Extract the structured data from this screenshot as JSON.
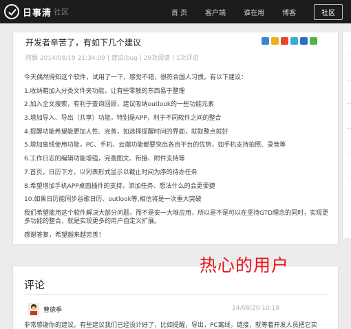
{
  "app": {
    "logo_text": "日事清",
    "logo_sub": "社区"
  },
  "nav": {
    "items": [
      "首 页",
      "客户端",
      "谁在用",
      "博客"
    ],
    "community": "社区"
  },
  "article": {
    "title": "开发者辛苦了，有如下几个建议",
    "meta": "阿飘 2014/08/19 21:34:09 | 建议/bug | 29次阅读 | 1次评论",
    "paragraphs": [
      "今天偶然得知这个软件，试用了一下，感觉不错，很符合国人习惯。有以下建议：",
      "1.收纳箱加入分类文件夹功能，让有些零散的东西易于整理",
      "2.加入全文搜索，有利于查询回顾，建议吸纳outlook的一些功能元素",
      "3.增加导入、导出（共享）功能，特别是APP，利于不同软件之间的整合",
      "4.提醒功能希望能更加人性、完善，如选择提醒时间的界面，就取整点就好",
      "5.增加离线使用功能，PC、手机、云端功能都要突出各自平台的优势，如手机支持拍照、录音等",
      "6.工作日志的编辑功能增强，完善图文、衔接、附件支持等",
      "7.首页，日历下方，以列表形式显示以截止时间为序的待办任务",
      "8.希望增加手机APP桌面插件的支持，添加任务、想法什么的会更便捷",
      "10.如果日历能同步谷歌日历、outlook等,相信将是一次重大突破",
      "我们希望能用这个软件解决大部分问题，而不是安一大堆应用，所以是不是可以在坚持GTD理念的同时，实现更多功能的整合，就是实现更多的用户自定义扩展。",
      "感谢答复，希望越来越完善！"
    ]
  },
  "annotation": "热心的用户",
  "comments": {
    "heading": "评论",
    "items": [
      {
        "author": "曹德季",
        "time": "14/08/20 10:18",
        "text": "非常感谢你的建议。有些建议我们已经设计好了，比如提醒，导出，PC离线，链接，就等着开发人员把它实"
      }
    ]
  },
  "colors": {
    "topbar": "#1c1c1c",
    "annotation": "#e8121c"
  },
  "icons": [
    "add-share-icon",
    "qzone-icon",
    "weibo-icon",
    "tencent-weibo-icon",
    "renren-icon",
    "wechat-icon"
  ]
}
